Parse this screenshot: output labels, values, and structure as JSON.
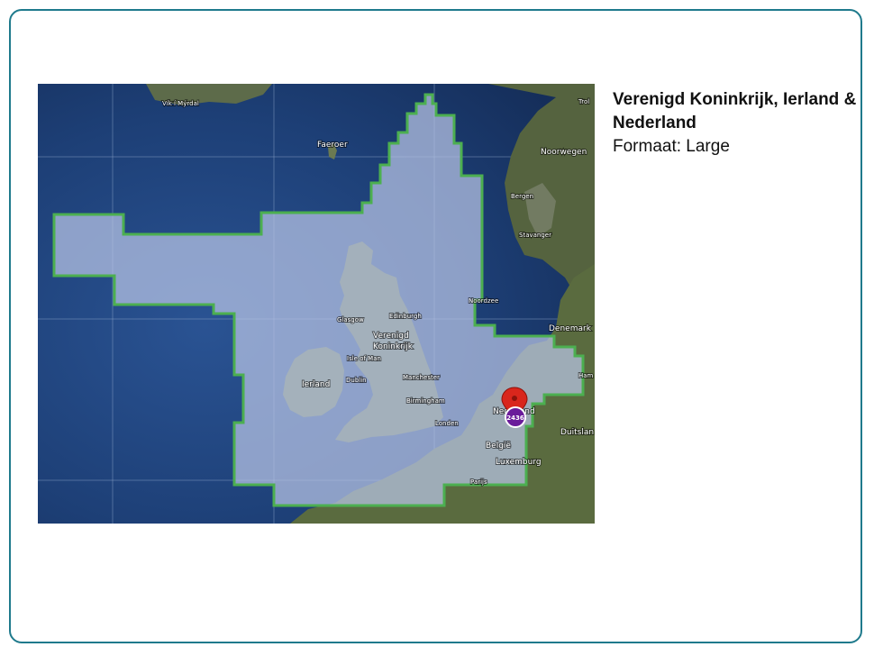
{
  "region": {
    "title": "Verenigd Koninkrijk, Ierland & Nederland",
    "format_label": "Formaat: Large"
  },
  "map": {
    "labels": {
      "vik": "Vík í Mýrdal",
      "faeroer": "Faeroer",
      "noorwegen": "Noorwegen",
      "bergen": "Bergen",
      "stavanger": "Stavanger",
      "tromso": "Trol",
      "noordzee": "Noordzee",
      "denemarken": "Denemark",
      "hamburg": "Ham",
      "glasgow": "Glasgow",
      "edinburgh": "Edinburgh",
      "uk": "Verenigd Koninkrijk",
      "isle_of_man": "Isle of Man",
      "ierland": "Ierland",
      "dublin": "Dublin",
      "manchester": "Manchester",
      "birmingham": "Birmingham",
      "londen": "Londen",
      "nederland": "Nederland",
      "belgie": "België",
      "luxemburg": "Luxemburg",
      "duitsland": "Duitslan",
      "parijs": "Parijs"
    },
    "marker_count": "2436",
    "colors": {
      "ocean": "#1d3f76",
      "selection_fill": "#b9c5e6",
      "selection_border": "#4caf50",
      "marker": "#d9261c",
      "cluster": "#6a1b9a"
    }
  }
}
